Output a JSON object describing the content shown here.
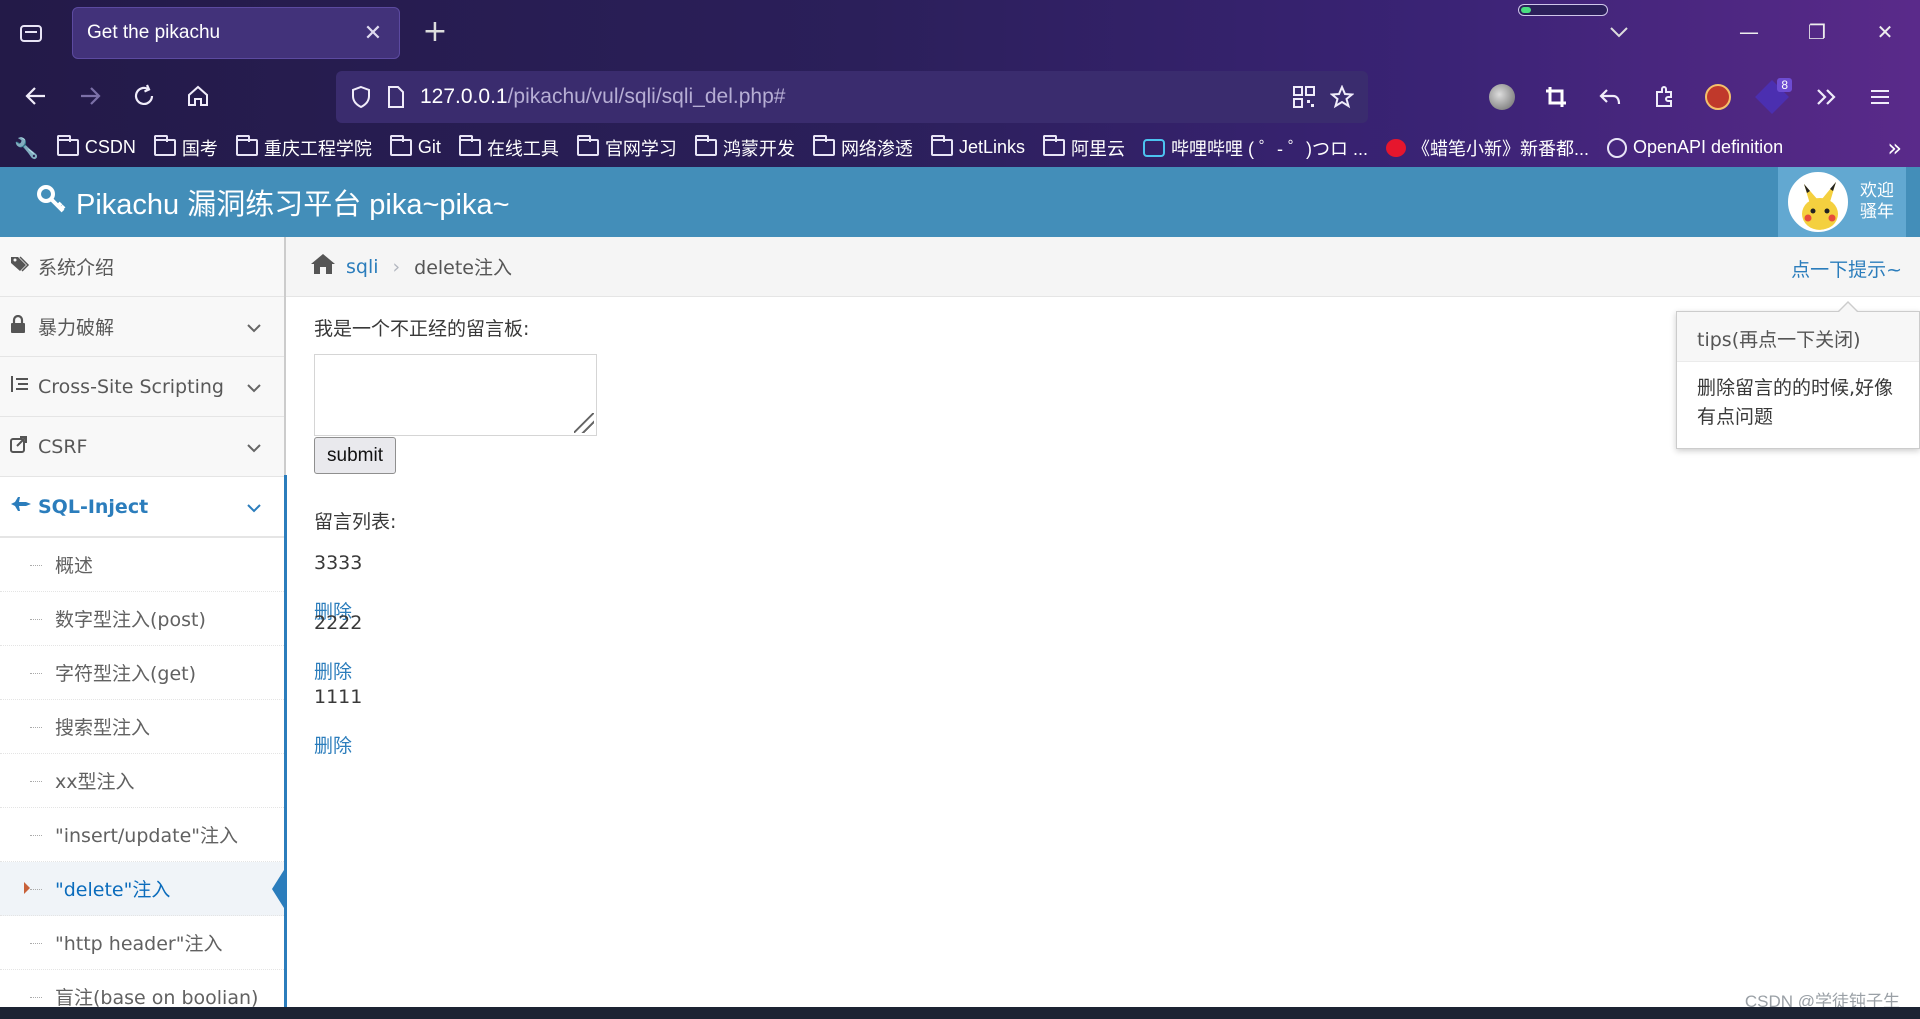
{
  "browser": {
    "tab_title": "Get the pikachu",
    "tab_close": "✕",
    "new_tab": "+",
    "load_progress": 0.12,
    "url_host": "127.0.0.1",
    "url_path": "/pikachu/vul/sqli/sqli_del.php#",
    "extension_badge": "8",
    "window_controls": {
      "minimize": "—",
      "restore": "❐",
      "close": "✕"
    },
    "bookmarks": [
      {
        "label": "CSDN",
        "icon": "folder-icon"
      },
      {
        "label": "国考",
        "icon": "folder-icon"
      },
      {
        "label": "重庆工程学院",
        "icon": "folder-icon"
      },
      {
        "label": "Git",
        "icon": "folder-icon"
      },
      {
        "label": "在线工具",
        "icon": "folder-icon"
      },
      {
        "label": "官网学习",
        "icon": "folder-icon"
      },
      {
        "label": "鸿蒙开发",
        "icon": "folder-icon"
      },
      {
        "label": "网络渗透",
        "icon": "folder-icon"
      },
      {
        "label": "JetLinks",
        "icon": "folder-icon"
      },
      {
        "label": "阿里云",
        "icon": "folder-icon"
      },
      {
        "label": "哔哩哔哩 ( ゜- ゜)つロ ...",
        "icon": "bilibili-icon"
      },
      {
        "label": "《蜡笔小新》新番都...",
        "icon": "weibo-icon"
      },
      {
        "label": "OpenAPI definition",
        "icon": "globe-icon"
      }
    ]
  },
  "header": {
    "brand": "Pikachu 漏洞练习平台 pika~pika~",
    "welcome": "欢迎",
    "username": "骚年"
  },
  "sidebar": {
    "items": [
      {
        "label": "系统介绍",
        "icon": "tags-icon"
      },
      {
        "label": "暴力破解",
        "icon": "lock-icon"
      },
      {
        "label": "Cross-Site Scripting",
        "icon": "list-icon"
      },
      {
        "label": "CSRF",
        "icon": "share-icon"
      },
      {
        "label": "SQL-Inject",
        "icon": "fighter-jet-icon"
      }
    ],
    "sub_items": [
      "概述",
      "数字型注入(post)",
      "字符型注入(get)",
      "搜索型注入",
      "xx型注入",
      "\"insert/update\"注入",
      "\"delete\"注入",
      "\"http header\"注入",
      "盲注(base on boolian)"
    ]
  },
  "breadcrumb": {
    "section": "sqli",
    "current": "delete注入",
    "hint": "点一下提示~"
  },
  "main": {
    "board_label": "我是一个不正经的留言板:",
    "textarea_value": "",
    "submit_label": "submit",
    "list_label": "留言列表:",
    "messages": [
      {
        "content": "3333",
        "delete": "删除"
      },
      {
        "content": "2222",
        "delete": "删除"
      },
      {
        "content": "1111",
        "delete": "删除"
      }
    ]
  },
  "tips": {
    "title": "tips(再点一下关闭)",
    "body": "删除留言的的时候,好像有点问题"
  },
  "watermark": "CSDN @学徒钝子生"
}
